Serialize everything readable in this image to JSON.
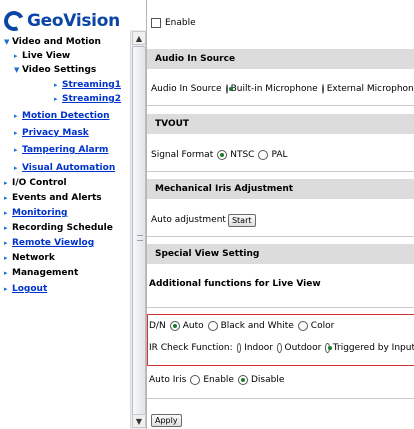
{
  "logo": {
    "text": "GeoVision"
  },
  "sidebar": {
    "items": [
      {
        "label": "Video and Motion",
        "arrow": "▼",
        "link": false
      },
      {
        "label": "Live View",
        "arrow": "▸",
        "link": false
      },
      {
        "label": "Video Settings",
        "arrow": "▼",
        "link": false
      },
      {
        "label": "Streaming1",
        "arrow": "▸",
        "link": true
      },
      {
        "label": "Streaming2",
        "arrow": "▸",
        "link": true
      },
      {
        "label": "Motion Detection",
        "arrow": "▸",
        "link": true
      },
      {
        "label": "Privacy Mask",
        "arrow": "▸",
        "link": true
      },
      {
        "label": "Tampering Alarm",
        "arrow": "▸",
        "link": true
      },
      {
        "label": "Visual Automation",
        "arrow": "▸",
        "link": true
      },
      {
        "label": "I/O Control",
        "arrow": "▸",
        "link": false
      },
      {
        "label": "Events and Alerts",
        "arrow": "▸",
        "link": false
      },
      {
        "label": "Monitoring",
        "arrow": "▸",
        "link": true
      },
      {
        "label": "Recording Schedule",
        "arrow": "▸",
        "link": false
      },
      {
        "label": "Remote Viewlog",
        "arrow": "▸",
        "link": true
      },
      {
        "label": "Network",
        "arrow": "▸",
        "link": false
      },
      {
        "label": "Management",
        "arrow": "▸",
        "link": false
      },
      {
        "label": "Logout",
        "arrow": "▸",
        "link": true
      }
    ],
    "scroll_up": "▲",
    "scroll_down": "▼"
  },
  "main": {
    "enable_label": "Enable",
    "audio": {
      "section": "Audio In Source",
      "label": "Audio In Source",
      "option1": "Built-in Microphone",
      "option2": "External Microphone",
      "selected": "Built-in Microphone"
    },
    "tvout": {
      "section": "TVOUT",
      "label": "Signal Format",
      "option1": "NTSC",
      "option2": "PAL",
      "selected": "NTSC"
    },
    "iris": {
      "section": "Mechanical Iris Adjustment",
      "label": "Auto adjustment",
      "start_button": "Start"
    },
    "special": {
      "section": "Special View Setting",
      "subtitle": "Additional functions for Live View",
      "dn_label": "D/N",
      "dn_options": [
        "Auto",
        "Black and White",
        "Color"
      ],
      "dn_selected": "Auto",
      "ir_label": "IR Check Function:",
      "ir_options": [
        "Indoor",
        "Outdoor",
        "Triggered by Input"
      ],
      "ir_selected": "Triggered by Input",
      "auto_iris_label": "Auto Iris",
      "auto_iris_options": [
        "Enable",
        "Disable"
      ],
      "auto_iris_selected": "Disable"
    },
    "apply_button": "Apply"
  },
  "colors": {
    "brand": "#0b45a6",
    "link": "#0033cc",
    "section_bg": "#dcdcdc",
    "highlight_border": "#d63333",
    "radio_dot": "#1b7d2c"
  }
}
